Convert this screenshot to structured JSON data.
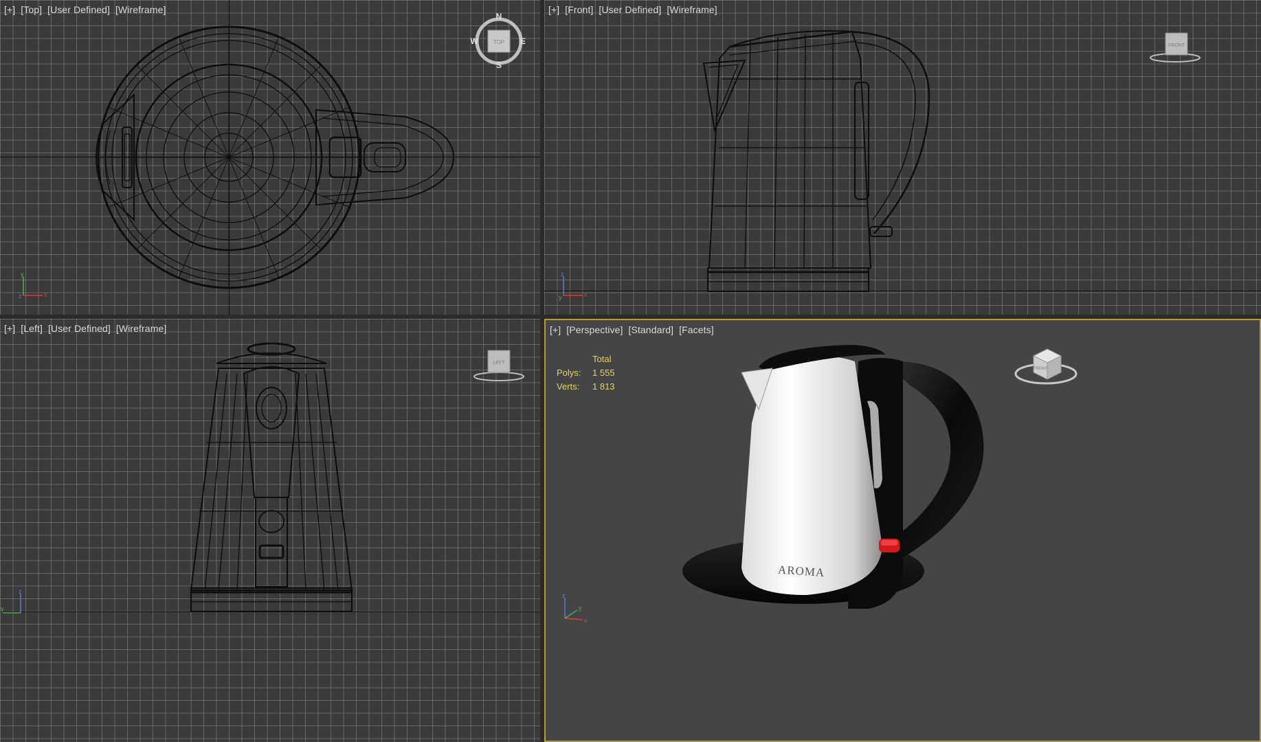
{
  "viewports": {
    "top": {
      "label": {
        "plus": "[+]",
        "view": "[Top]",
        "style": "[User Defined]",
        "shading": "[Wireframe]"
      },
      "viewcube": {
        "face": "TOP",
        "n": "N",
        "s": "S",
        "e": "E",
        "w": "W"
      }
    },
    "front": {
      "label": {
        "plus": "[+]",
        "view": "[Front]",
        "style": "[User Defined]",
        "shading": "[Wireframe]"
      },
      "viewcube": {
        "face": "FRONT"
      }
    },
    "left": {
      "label": {
        "plus": "[+]",
        "view": "[Left]",
        "style": "[User Defined]",
        "shading": "[Wireframe]"
      },
      "viewcube": {
        "face": "LEFT"
      }
    },
    "perspective": {
      "label": {
        "plus": "[+]",
        "view": "[Perspective]",
        "style": "[Standard]",
        "shading": "[Facets]"
      },
      "viewcube": {
        "face": "FRONT"
      },
      "stats": {
        "header": "Total",
        "polys_label": "Polys:",
        "polys": "1 555",
        "verts_label": "Verts:",
        "verts": "1 813"
      },
      "brand": "AROMA"
    }
  },
  "axes": {
    "x": "x",
    "y": "y",
    "z": "z"
  },
  "colors": {
    "active_border": "#b59a3f",
    "stats_text": "#e6d25a",
    "grid_bg": "#3a3a3a",
    "wire": "#0d0d0d"
  }
}
